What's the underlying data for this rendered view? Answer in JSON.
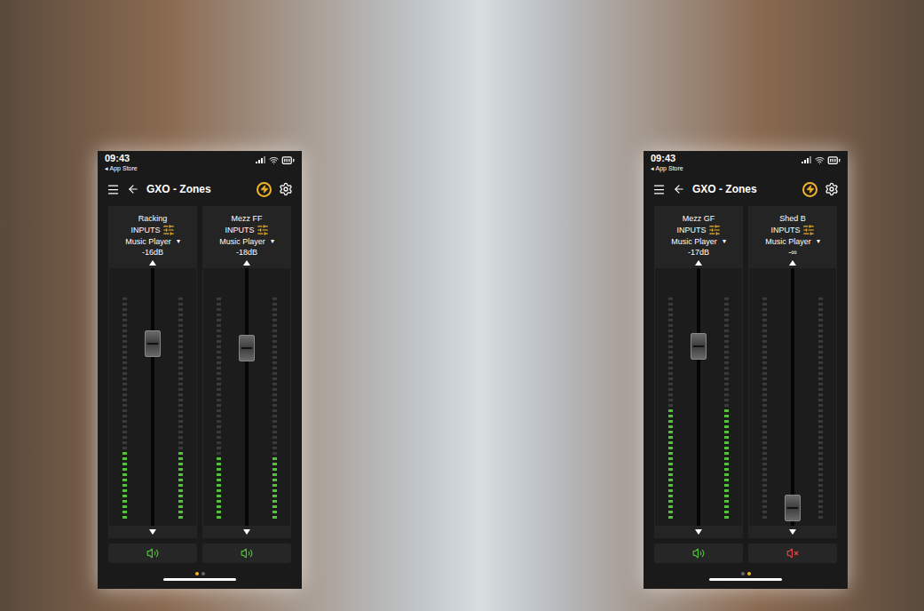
{
  "screens": [
    {
      "status_bar": {
        "time": "09:43",
        "back_link": "◂ App Store"
      },
      "header": {
        "title": "GXO - Zones"
      },
      "channels": [
        {
          "name": "Racking",
          "input_label": "INPUTS",
          "source": "Music Player",
          "dropdown": "▾",
          "reading": "-16dB",
          "level": 0.73,
          "meter": 0.3,
          "muted": false
        },
        {
          "name": "Mezz FF",
          "input_label": "INPUTS",
          "source": "Music Player",
          "dropdown": "▾",
          "reading": "-18dB",
          "level": 0.71,
          "meter": 0.28,
          "muted": false
        }
      ],
      "page_dots": [
        {
          "selected": true
        },
        {
          "selected": false
        }
      ]
    },
    {
      "status_bar": {
        "time": "09:43",
        "back_link": "◂ App Store"
      },
      "header": {
        "title": "GXO - Zones"
      },
      "channels": [
        {
          "name": "Mezz GF",
          "input_label": "INPUTS",
          "source": "Music Player",
          "dropdown": "▾",
          "reading": "-17dB",
          "level": 0.72,
          "meter": 0.5,
          "muted": false
        },
        {
          "name": "Shed B",
          "input_label": "INPUTS",
          "source": "Music Player",
          "dropdown": "▾",
          "reading": "-∞",
          "level": 0.02,
          "meter": 0,
          "muted": true
        }
      ],
      "page_dots": [
        {
          "selected": false
        },
        {
          "selected": true
        }
      ]
    }
  ]
}
